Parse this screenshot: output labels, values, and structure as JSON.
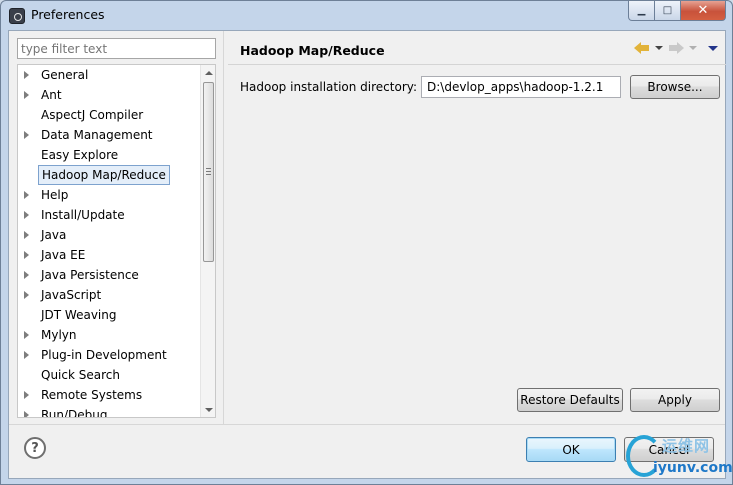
{
  "window": {
    "title": "Preferences",
    "buttons": {
      "minimize": "▁",
      "maximize": "□",
      "close": "✕"
    }
  },
  "filter": {
    "placeholder": "type filter text",
    "value": ""
  },
  "tree": {
    "items": [
      {
        "label": "General",
        "expandable": true,
        "selected": false
      },
      {
        "label": "Ant",
        "expandable": true,
        "selected": false
      },
      {
        "label": "AspectJ Compiler",
        "expandable": false,
        "selected": false
      },
      {
        "label": "Data Management",
        "expandable": true,
        "selected": false
      },
      {
        "label": "Easy Explore",
        "expandable": false,
        "selected": false
      },
      {
        "label": "Hadoop Map/Reduce",
        "expandable": false,
        "selected": true
      },
      {
        "label": "Help",
        "expandable": true,
        "selected": false
      },
      {
        "label": "Install/Update",
        "expandable": true,
        "selected": false
      },
      {
        "label": "Java",
        "expandable": true,
        "selected": false
      },
      {
        "label": "Java EE",
        "expandable": true,
        "selected": false
      },
      {
        "label": "Java Persistence",
        "expandable": true,
        "selected": false
      },
      {
        "label": "JavaScript",
        "expandable": true,
        "selected": false
      },
      {
        "label": "JDT Weaving",
        "expandable": false,
        "selected": false
      },
      {
        "label": "Mylyn",
        "expandable": true,
        "selected": false
      },
      {
        "label": "Plug-in Development",
        "expandable": true,
        "selected": false
      },
      {
        "label": "Quick Search",
        "expandable": false,
        "selected": false
      },
      {
        "label": "Remote Systems",
        "expandable": true,
        "selected": false
      },
      {
        "label": "Run/Debug",
        "expandable": true,
        "selected": false
      }
    ]
  },
  "page": {
    "title": "Hadoop Map/Reduce",
    "install_dir_label": "Hadoop installation directory:",
    "install_dir_value": "D:\\devlop_apps\\hadoop-1.2.1",
    "browse_label": "Browse...",
    "restore_defaults_label": "Restore Defaults",
    "apply_label": "Apply"
  },
  "footer": {
    "help_glyph": "?",
    "ok_label": "OK",
    "cancel_label": "Cancel"
  },
  "watermark": {
    "chinese_text": "运维网",
    "url": "iyunv.com"
  },
  "colors": {
    "accent_blue": "#3c7fb1",
    "selection_fill": "#e4eef9",
    "back_arrow": "#e2b33a",
    "close_button": "#c8523b"
  }
}
